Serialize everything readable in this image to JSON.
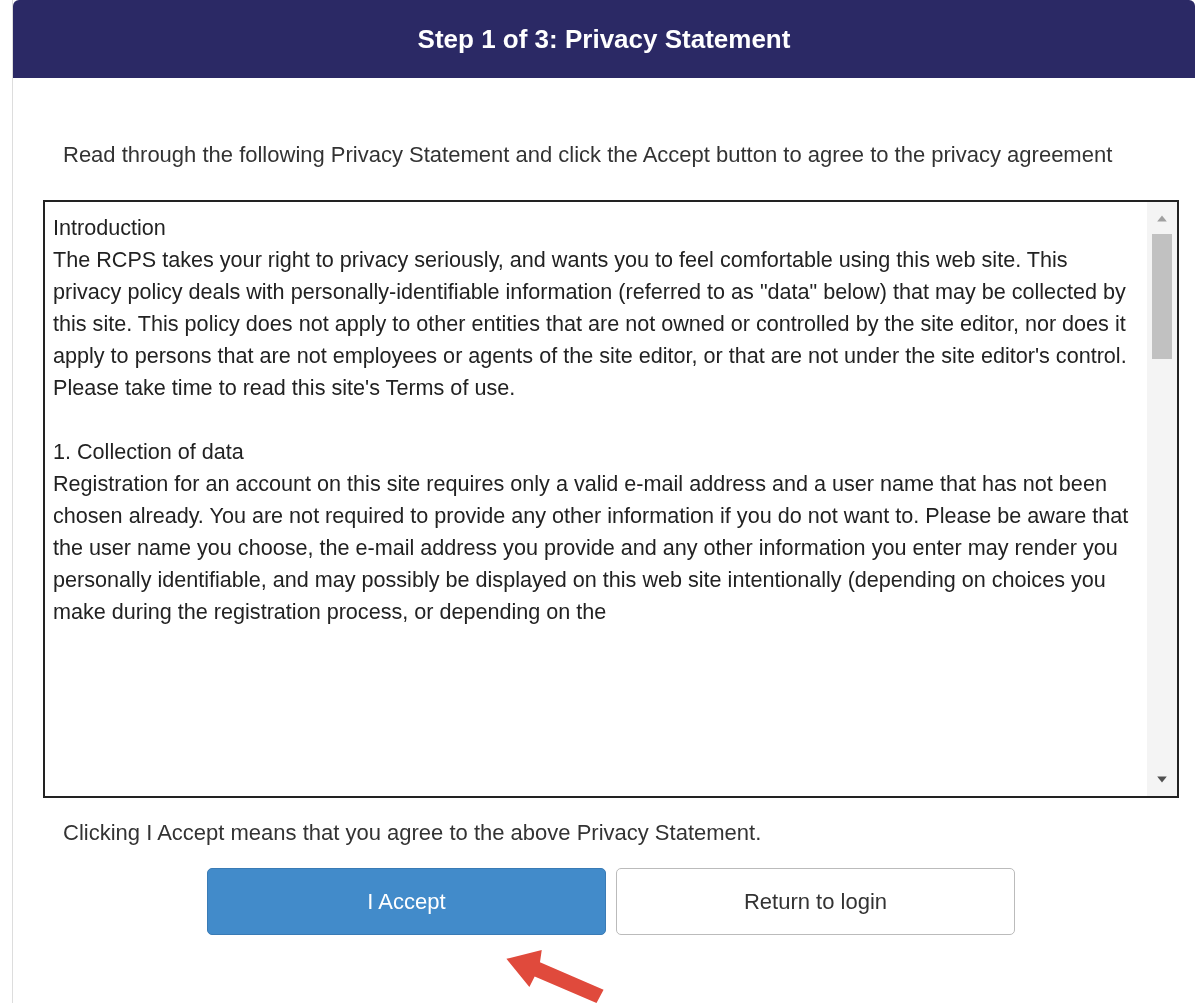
{
  "header": {
    "title": "Step 1 of 3: Privacy Statement"
  },
  "instructions": "Read through the following Privacy Statement and click the Accept button to agree to the privacy agreement",
  "statement": {
    "sections": [
      {
        "heading": "Introduction",
        "body": "The RCPS takes your right to privacy seriously, and wants you to feel comfortable using this web site. This privacy policy deals with personally-identifiable information (referred to as \"data\" below) that may be collected by this site. This policy does not apply to other entities that are not owned or controlled by the site editor, nor does it apply to persons that are not employees or agents of the site editor, or that are not under the site editor's control. Please take time to read this site's Terms of use."
      },
      {
        "heading": "1. Collection of data",
        "body": "Registration for an account on this site requires only a valid e-mail address and a user name that has not been chosen already. You are not required to provide any other information if you do not want to. Please be aware that the user name you choose, the e-mail address you provide and any other information you enter may render you personally identifiable, and may possibly be displayed on this web site intentionally (depending on choices you make during the registration process, or depending on the"
      }
    ]
  },
  "note": "Clicking I Accept means that you agree to the above Privacy Statement.",
  "buttons": [
    {
      "label": "I Accept",
      "kind": "primary"
    },
    {
      "label": "Return to login",
      "kind": "secondary"
    }
  ]
}
